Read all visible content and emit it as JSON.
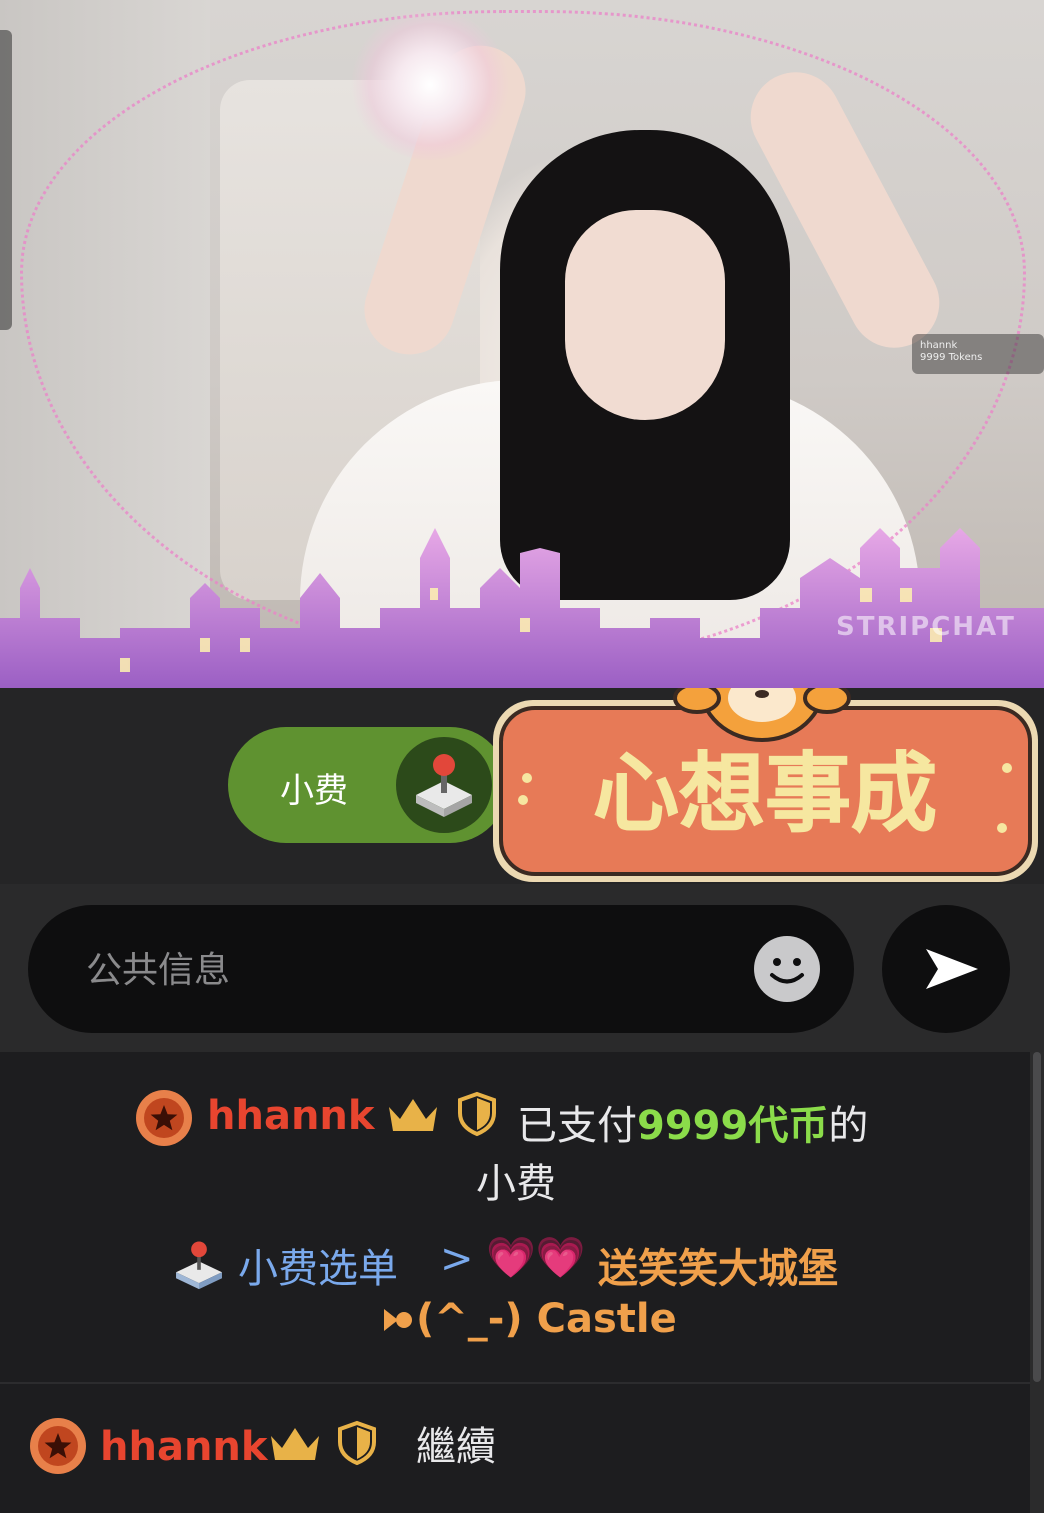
{
  "video": {
    "watermark": "STRIPCHAT",
    "overlay_user": "hhannk",
    "overlay_tokens": "9999 Tokens"
  },
  "tip": {
    "button_label": "小费",
    "sticker_text": "心想事成"
  },
  "composer": {
    "placeholder": "公共信息"
  },
  "chat": {
    "messages": [
      {
        "username": "hhannk",
        "text_prefix": "已支付",
        "amount": "9999代币",
        "text_suffix": "的",
        "text_line2": "小费",
        "menu_label": "小费选单",
        "chevron": ">",
        "gift_hearts": "💗💗",
        "gift_name": "送笑笑大城堡",
        "gift_line2": "(^_-) Castle"
      },
      {
        "username": "hhannk",
        "text": "繼續"
      }
    ]
  },
  "colors": {
    "tip_green": "#5f9230",
    "username_red": "#e8452f",
    "amount_green": "#8bdc4a",
    "menu_blue": "#7aa9ec",
    "gift_orange": "#f0a04b"
  }
}
